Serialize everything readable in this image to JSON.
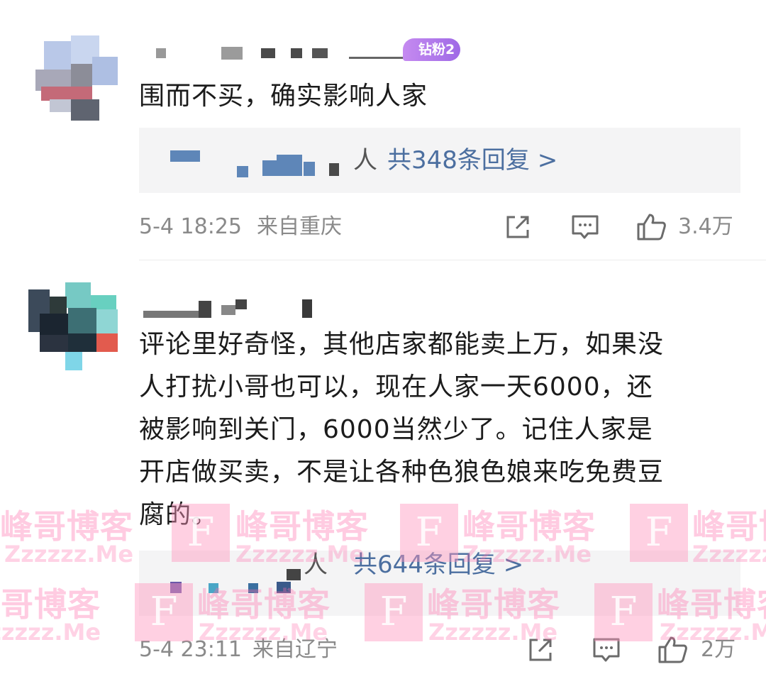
{
  "comments": [
    {
      "badge": "钻粉2",
      "text": "围而不买，确实影响人家",
      "reply_partial_glyph": "人",
      "reply_count_label": "共348条回复 >",
      "time": "5-4 18:25",
      "location": "来自重庆",
      "likes": "3.4万"
    },
    {
      "text_lines": [
        "评论里好奇怪，其他店家都能卖上万，如果没",
        "人打扰小哥也可以，现在人家一天6000，还",
        "被影响到关门，6000当然少了。记住人家是",
        "开店做买卖，不是让各种色狼色娘来吃免费豆",
        "腐的。"
      ],
      "reply_partial_glyph": "人",
      "reply_count_label": "共644条回复 >",
      "time": "5-4 23:11",
      "location": "来自辽宁",
      "likes": "2万"
    }
  ],
  "icons": {
    "share": "share-icon",
    "comment": "comment-icon",
    "like": "thumbs-up-icon"
  },
  "watermark": {
    "cn": "峰哥博客",
    "en": "Zzzzzz.Me",
    "logo_letter": "F"
  },
  "colors": {
    "link": "#4c6fa0",
    "meta": "#8a8a8a",
    "badge": "#b07ce9",
    "watermark": "#ff69aa"
  }
}
